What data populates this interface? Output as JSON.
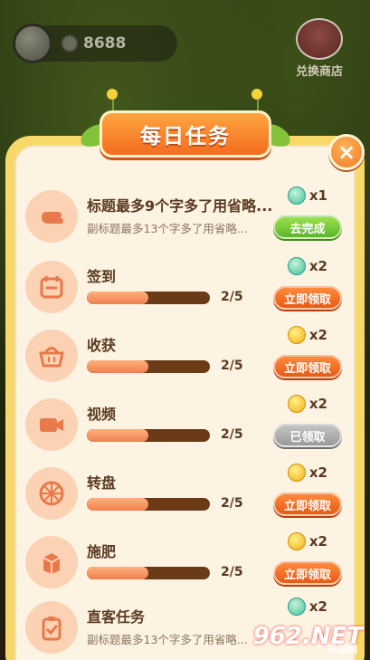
{
  "hud": {
    "coin_amount": "8688",
    "shop_label": "兑换商店"
  },
  "panel": {
    "title": "每日任务",
    "close_label": "×"
  },
  "tasks": [
    {
      "name": "标题最多9个字多了用省略...",
      "subtitle": "副标题最多13个字多了用省略...",
      "reward_type": "gem",
      "reward_count": "x1",
      "button_label": "去完成",
      "button_style": "green",
      "icon": "hand-icon"
    },
    {
      "name": "签到",
      "progress_text": "2/5",
      "progress": 0.5,
      "reward_type": "gem",
      "reward_count": "x2",
      "button_label": "立即领取",
      "button_style": "orange",
      "icon": "calendar-icon"
    },
    {
      "name": "收获",
      "progress_text": "2/5",
      "progress": 0.5,
      "reward_type": "coin",
      "reward_count": "x2",
      "button_label": "立即领取",
      "button_style": "orange",
      "icon": "basket-icon"
    },
    {
      "name": "视频",
      "progress_text": "2/5",
      "progress": 0.5,
      "reward_type": "coin",
      "reward_count": "x2",
      "button_label": "已领取",
      "button_style": "gray",
      "icon": "video-icon"
    },
    {
      "name": "转盘",
      "progress_text": "2/5",
      "progress": 0.5,
      "reward_type": "coin",
      "reward_count": "x2",
      "button_label": "立即领取",
      "button_style": "orange",
      "icon": "wheel-icon"
    },
    {
      "name": "施肥",
      "progress_text": "2/5",
      "progress": 0.5,
      "reward_type": "coin",
      "reward_count": "x2",
      "button_label": "立即领取",
      "button_style": "orange",
      "icon": "fertilizer-icon"
    },
    {
      "name": "直客任务",
      "subtitle": "副标题最多13个字多了用省略...",
      "reward_type": "gem",
      "reward_count": "x2",
      "icon": "clipboard-icon"
    }
  ],
  "watermark": {
    "main": "962.NET",
    "sub": "乐游网"
  }
}
